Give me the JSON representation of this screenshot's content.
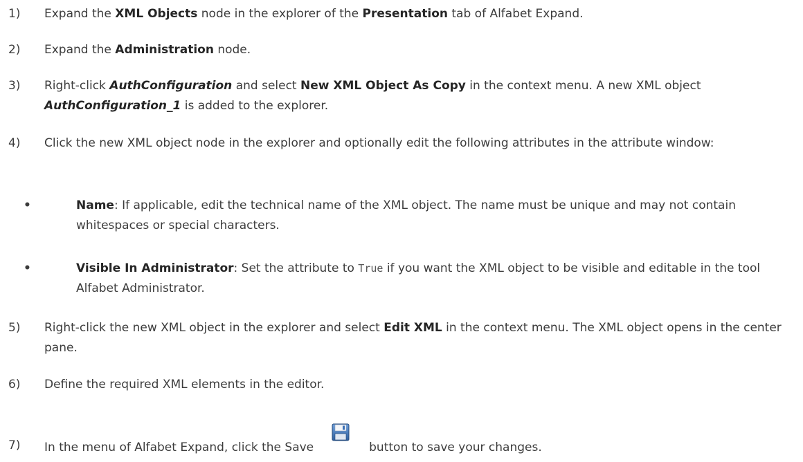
{
  "steps": [
    {
      "num": "1)",
      "a": "Expand the ",
      "b": "XML Objects",
      "c": " node in the explorer of the ",
      "d": "Presentation",
      "e": " tab of Alfabet Expand."
    },
    {
      "num": "2)",
      "a": "Expand the ",
      "b": "Administration",
      "c": " node."
    },
    {
      "num": "3)",
      "a": "Right-click ",
      "b": "AuthConfiguration",
      "c": " and select ",
      "d": "New XML Object As Copy",
      "e": " in the context menu. A new XML object ",
      "f": "AuthConfiguration_1",
      "g": " is added to the explorer."
    },
    {
      "num": "4)",
      "a": "Click the new XML object node in the explorer and optionally edit the following attributes in the attribute window:"
    },
    {
      "num": "5)",
      "a": "Right-click the new XML object in the explorer and select ",
      "b": "Edit XML",
      "c": " in the context menu. The XML object opens in the center pane."
    },
    {
      "num": "6)",
      "a": "Define the required XML elements in the editor."
    },
    {
      "num": "7)",
      "a": "In the menu of Alfabet Expand, click the Save",
      "c": "button to save your changes."
    }
  ],
  "bullets": [
    {
      "label": "Name",
      "text": ": If applicable, edit the technical name of the XML object. The name must be unique and may not contain whitespaces or special characters."
    },
    {
      "label": "Visible In Administrator",
      "text_a": ": Set the attribute to ",
      "code": "True",
      "text_b": " if you want the XML object to be visible and editable in the tool Alfabet Administrator."
    }
  ],
  "icons": {
    "save": "save-floppy-icon"
  },
  "colors": {
    "text": "#3c3c3c",
    "bold": "#262626",
    "icon_blue": "#3a6fb5"
  }
}
